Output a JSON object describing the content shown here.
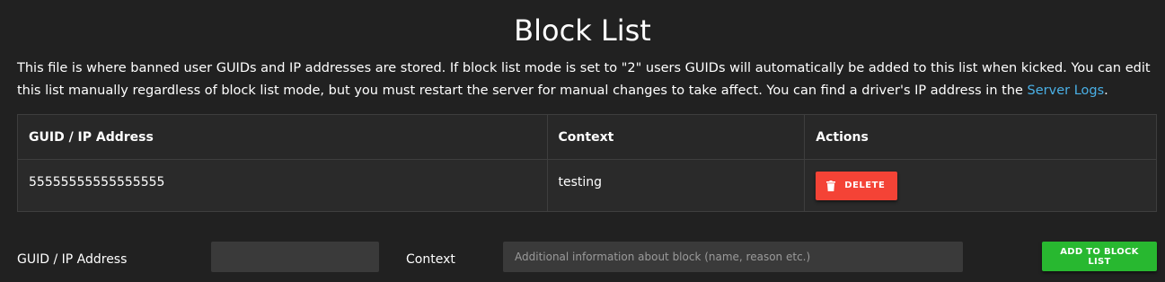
{
  "page": {
    "title": "Block List",
    "description_prefix": "This file is where banned user GUIDs and IP addresses are stored. If block list mode is set to \"2\" users GUIDs will automatically be added to this list when kicked. You can edit this list manually regardless of block list mode, but you must restart the server for manual changes to take affect. You can find a driver's IP address in the ",
    "description_link": "Server Logs",
    "description_suffix": "."
  },
  "table": {
    "headers": {
      "guid": "GUID / IP Address",
      "context": "Context",
      "actions": "Actions"
    },
    "rows": [
      {
        "guid": "55555555555555555",
        "context": "testing",
        "delete_label": "DELETE",
        "delete_icon": "trash-icon"
      }
    ]
  },
  "form": {
    "guid_label": "GUID / IP Address",
    "guid_value": "",
    "context_label": "Context",
    "context_value": "",
    "context_placeholder": "Additional information about block (name, reason etc.)",
    "add_label": "ADD TO BLOCK LIST"
  },
  "colors": {
    "background": "#212121",
    "link": "#4ab0e6",
    "delete": "#f44336",
    "add": "#28b830"
  }
}
